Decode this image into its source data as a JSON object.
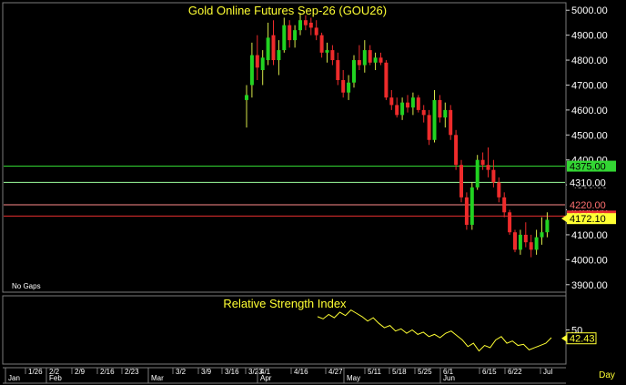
{
  "chart_data": [
    {
      "type": "candlestick",
      "title": "Gold Online Futures Sep-26 (GOU26)",
      "note": "No Gaps",
      "ylim": [
        3870,
        5030
      ],
      "y_ticks": [
        "5000.00",
        "4900.00",
        "4800.00",
        "4700.00",
        "4600.00",
        "4500.00",
        "4400.00",
        "4300.00",
        "4200.00",
        "4100.00",
        "4000.00",
        "3900.00"
      ],
      "y_tick_values": [
        5000,
        4900,
        4800,
        4700,
        4600,
        4500,
        4400,
        4300,
        4200,
        4100,
        4000,
        3900
      ],
      "horizontal_lines": [
        {
          "value": 4375,
          "label": "4375.00",
          "color": "#33d633",
          "label_bg": "#33d633",
          "label_fg": "#000000"
        },
        {
          "value": 4310,
          "label": "4310.00",
          "color": "#9dff9d",
          "label_bg": "#000000",
          "label_fg": "#ffffff"
        },
        {
          "value": 4220,
          "label": "4220.00",
          "color": "#ff8c8c",
          "label_bg": "#000000",
          "label_fg": "#ff7070"
        },
        {
          "value": 4175,
          "label": "4175.00",
          "color": "#e83030",
          "label_bg": "#e83030",
          "label_fg": "#ffffff"
        }
      ],
      "last_price": {
        "value": 4172.1,
        "label": "4172.10",
        "bg": "#ffff33",
        "fg": "#000000"
      },
      "candles": [
        {
          "o": 4640,
          "h": 4700,
          "l": 4530,
          "c": 4660
        },
        {
          "o": 4700,
          "h": 4870,
          "l": 4650,
          "c": 4820
        },
        {
          "o": 4820,
          "h": 4900,
          "l": 4720,
          "c": 4770
        },
        {
          "o": 4760,
          "h": 4840,
          "l": 4700,
          "c": 4810
        },
        {
          "o": 4800,
          "h": 4950,
          "l": 4780,
          "c": 4890
        },
        {
          "o": 4900,
          "h": 4960,
          "l": 4780,
          "c": 4800
        },
        {
          "o": 4800,
          "h": 4880,
          "l": 4740,
          "c": 4840
        },
        {
          "o": 4840,
          "h": 4970,
          "l": 4830,
          "c": 4940
        },
        {
          "o": 4940,
          "h": 4960,
          "l": 4850,
          "c": 4880
        },
        {
          "o": 4880,
          "h": 4940,
          "l": 4850,
          "c": 4920
        },
        {
          "o": 4920,
          "h": 4990,
          "l": 4900,
          "c": 4960
        },
        {
          "o": 4960,
          "h": 4980,
          "l": 4920,
          "c": 4940
        },
        {
          "o": 4950,
          "h": 4970,
          "l": 4900,
          "c": 4930
        },
        {
          "o": 4930,
          "h": 4960,
          "l": 4880,
          "c": 4900
        },
        {
          "o": 4900,
          "h": 4910,
          "l": 4810,
          "c": 4830
        },
        {
          "o": 4830,
          "h": 4870,
          "l": 4790,
          "c": 4840
        },
        {
          "o": 4840,
          "h": 4860,
          "l": 4780,
          "c": 4800
        },
        {
          "o": 4800,
          "h": 4830,
          "l": 4700,
          "c": 4720
        },
        {
          "o": 4720,
          "h": 4760,
          "l": 4650,
          "c": 4670
        },
        {
          "o": 4670,
          "h": 4740,
          "l": 4640,
          "c": 4710
        },
        {
          "o": 4710,
          "h": 4820,
          "l": 4690,
          "c": 4800
        },
        {
          "o": 4800,
          "h": 4860,
          "l": 4760,
          "c": 4780
        },
        {
          "o": 4780,
          "h": 4880,
          "l": 4750,
          "c": 4840
        },
        {
          "o": 4840,
          "h": 4860,
          "l": 4780,
          "c": 4790
        },
        {
          "o": 4790,
          "h": 4830,
          "l": 4760,
          "c": 4810
        },
        {
          "o": 4810,
          "h": 4830,
          "l": 4780,
          "c": 4790
        },
        {
          "o": 4790,
          "h": 4800,
          "l": 4640,
          "c": 4650
        },
        {
          "o": 4650,
          "h": 4680,
          "l": 4600,
          "c": 4620
        },
        {
          "o": 4620,
          "h": 4650,
          "l": 4570,
          "c": 4580
        },
        {
          "o": 4580,
          "h": 4650,
          "l": 4560,
          "c": 4630
        },
        {
          "o": 4630,
          "h": 4660,
          "l": 4590,
          "c": 4610
        },
        {
          "o": 4610,
          "h": 4670,
          "l": 4580,
          "c": 4650
        },
        {
          "o": 4650,
          "h": 4660,
          "l": 4590,
          "c": 4600
        },
        {
          "o": 4600,
          "h": 4620,
          "l": 4550,
          "c": 4580
        },
        {
          "o": 4580,
          "h": 4600,
          "l": 4460,
          "c": 4480
        },
        {
          "o": 4480,
          "h": 4680,
          "l": 4470,
          "c": 4640
        },
        {
          "o": 4640,
          "h": 4660,
          "l": 4550,
          "c": 4570
        },
        {
          "o": 4570,
          "h": 4630,
          "l": 4530,
          "c": 4600
        },
        {
          "o": 4600,
          "h": 4620,
          "l": 4480,
          "c": 4500
        },
        {
          "o": 4500,
          "h": 4520,
          "l": 4360,
          "c": 4380
        },
        {
          "o": 4380,
          "h": 4400,
          "l": 4230,
          "c": 4250
        },
        {
          "o": 4250,
          "h": 4270,
          "l": 4120,
          "c": 4140
        },
        {
          "o": 4140,
          "h": 4310,
          "l": 4120,
          "c": 4290
        },
        {
          "o": 4290,
          "h": 4420,
          "l": 4280,
          "c": 4400
        },
        {
          "o": 4400,
          "h": 4430,
          "l": 4360,
          "c": 4380
        },
        {
          "o": 4380,
          "h": 4450,
          "l": 4330,
          "c": 4360
        },
        {
          "o": 4360,
          "h": 4400,
          "l": 4290,
          "c": 4310
        },
        {
          "o": 4310,
          "h": 4330,
          "l": 4230,
          "c": 4250
        },
        {
          "o": 4250,
          "h": 4270,
          "l": 4170,
          "c": 4190
        },
        {
          "o": 4190,
          "h": 4200,
          "l": 4100,
          "c": 4110
        },
        {
          "o": 4110,
          "h": 4120,
          "l": 4030,
          "c": 4040
        },
        {
          "o": 4040,
          "h": 4120,
          "l": 4020,
          "c": 4100
        },
        {
          "o": 4100,
          "h": 4150,
          "l": 4050,
          "c": 4070
        },
        {
          "o": 4070,
          "h": 4100,
          "l": 4010,
          "c": 4040
        },
        {
          "o": 4040,
          "h": 4120,
          "l": 4020,
          "c": 4090
        },
        {
          "o": 4090,
          "h": 4170,
          "l": 4060,
          "c": 4110
        },
        {
          "o": 4110,
          "h": 4190,
          "l": 4090,
          "c": 4160
        }
      ]
    },
    {
      "type": "line",
      "title": "Relative Strength Index",
      "ylim": [
        20,
        80
      ],
      "y_ticks": [
        "50"
      ],
      "y_tick_values": [
        50
      ],
      "last_value": {
        "value": 42.43,
        "label": "42.43",
        "bg": "#000000",
        "fg": "#ffff33"
      },
      "series": [
        {
          "color": "#ffff33",
          "values": [
            62,
            60,
            64,
            61,
            66,
            63,
            68,
            65,
            62,
            58,
            61,
            56,
            52,
            54,
            49,
            51,
            47,
            50,
            46,
            48,
            44,
            46,
            43,
            47,
            49,
            45,
            41,
            35,
            38,
            31,
            36,
            34,
            41,
            44,
            38,
            40,
            36,
            37,
            32,
            34,
            36,
            38,
            43
          ]
        }
      ]
    }
  ],
  "time_axis": {
    "labels": [
      "Jan",
      "1/26",
      "2/2",
      "Feb",
      "2/9",
      "2/16",
      "2/23",
      "Mar",
      "3/2",
      "3/9",
      "3/16",
      "3/23",
      "4/1",
      "Apr",
      "4/16",
      "4/27",
      "May",
      "5/11",
      "5/18",
      "5/25",
      "6/1",
      "Jun",
      "6/15",
      "6/22",
      "Jul"
    ],
    "period": "Day"
  }
}
